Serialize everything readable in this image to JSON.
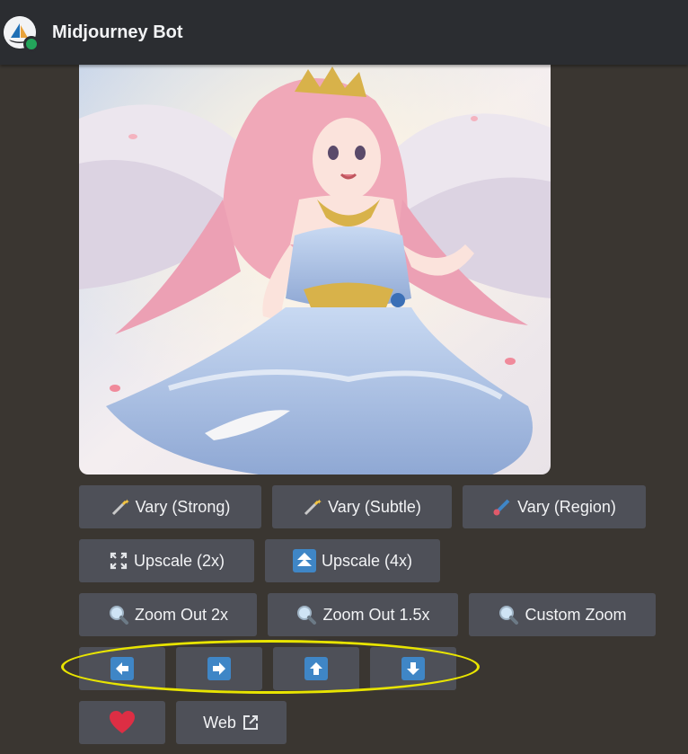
{
  "header": {
    "bot_name": "Midjourney Bot"
  },
  "image": {
    "description_icon": "generated-anime-angel-image"
  },
  "buttons": {
    "vary_strong": "Vary (Strong)",
    "vary_subtle": "Vary (Subtle)",
    "vary_region": "Vary (Region)",
    "upscale_2x": "Upscale (2x)",
    "upscale_4x": "Upscale (4x)",
    "zoom_out_2x": "Zoom Out 2x",
    "zoom_out_1_5x": "Zoom Out 1.5x",
    "custom_zoom": "Custom Zoom",
    "web": "Web"
  },
  "colors": {
    "background": "#3a3631",
    "header": "#2b2d31",
    "button": "#4e5058",
    "arrow_blue": "#3f86c6",
    "highlight": "#e8e400",
    "heart": "#dd2e44",
    "online": "#23a55a"
  }
}
